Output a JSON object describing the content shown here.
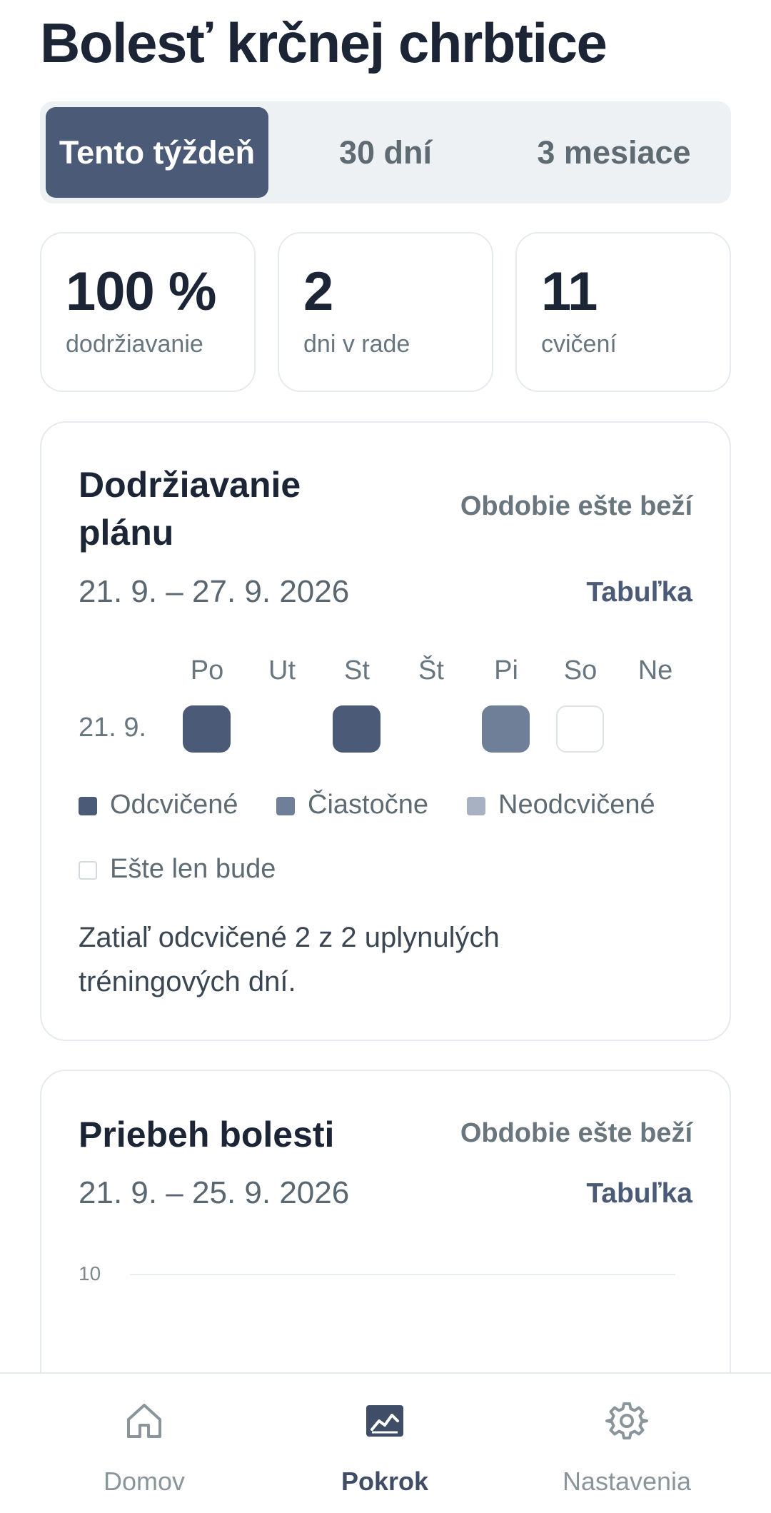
{
  "header": {
    "title": "Bolesť krčnej chrbtice"
  },
  "period_tabs": [
    {
      "label": "Tento týždeň",
      "active": true
    },
    {
      "label": "30 dní",
      "active": false
    },
    {
      "label": "3 mesiace",
      "active": false
    }
  ],
  "stats": [
    {
      "value": "100 %",
      "label": "dodržiavanie"
    },
    {
      "value": "2",
      "label": "dni v rade"
    },
    {
      "value": "11",
      "label": "cvičení"
    }
  ],
  "adherence": {
    "title": "Dodržiavanie plánu",
    "status": "Obdobie ešte beží",
    "range": "21. 9. – 27. 9. 2026",
    "table_link": "Tabuľka",
    "days": [
      "Po",
      "Ut",
      "St",
      "Št",
      "Pi",
      "So",
      "Ne"
    ],
    "week_label": "21. 9.",
    "cells": [
      "done",
      "none",
      "done",
      "none",
      "partial",
      "future",
      "none"
    ],
    "legend": [
      {
        "label": "Odcvičené",
        "color": "#4b5a76"
      },
      {
        "label": "Čiastočne",
        "color": "#6f7f98"
      },
      {
        "label": "Neodcvičené",
        "color": "#a7b1c2"
      },
      {
        "label": "Ešte len bude",
        "color": "#ffffff"
      }
    ],
    "summary": "Zatiaľ odcvičené 2 z 2 uplynulých tréningových dní."
  },
  "pain": {
    "title": "Priebeh bolesti",
    "status": "Obdobie ešte beží",
    "range": "21. 9. – 25. 9. 2026",
    "table_link": "Tabuľka",
    "y_tick": "10"
  },
  "nav": [
    {
      "label": "Domov",
      "icon": "home-icon",
      "active": false
    },
    {
      "label": "Pokrok",
      "icon": "chart-icon",
      "active": true
    },
    {
      "label": "Nastavenia",
      "icon": "gear-icon",
      "active": false
    }
  ],
  "colors": {
    "accent": "#4b5a76",
    "partial": "#6f7f98",
    "missed": "#a7b1c2",
    "title": "#1b2536"
  }
}
